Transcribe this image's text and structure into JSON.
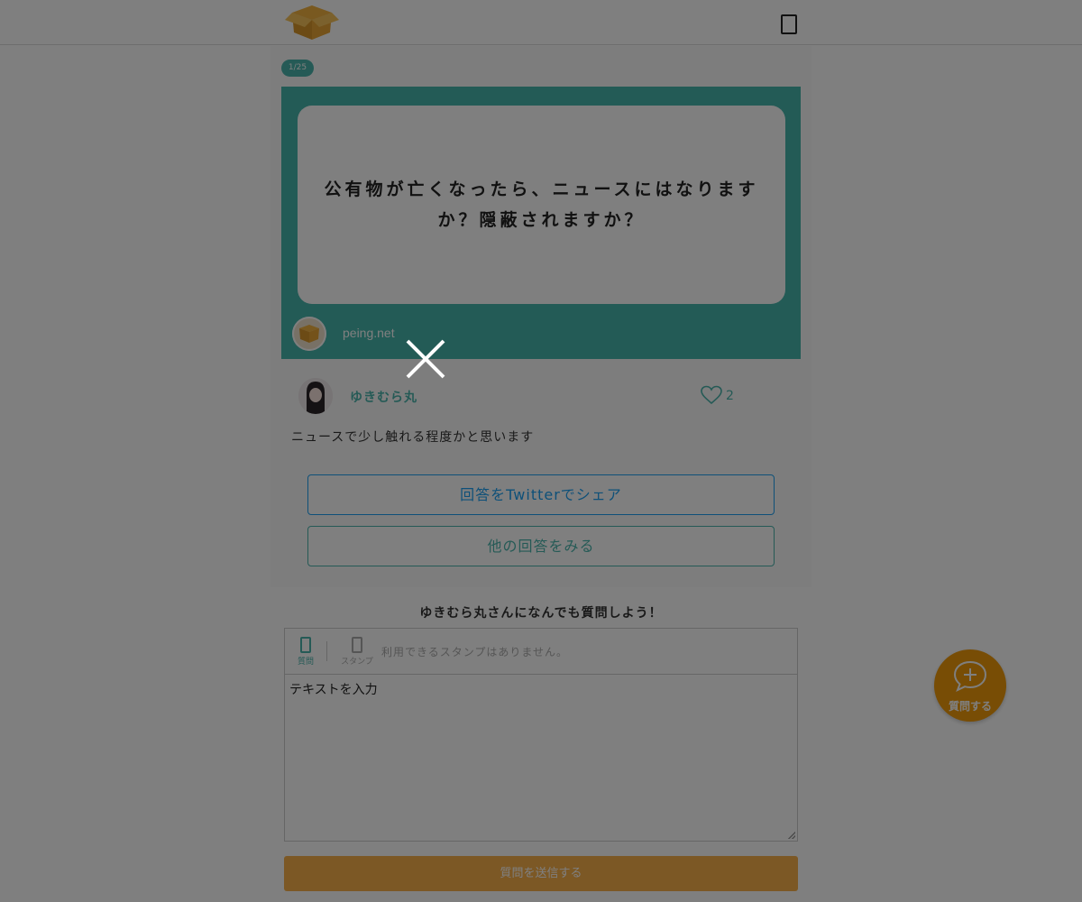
{
  "header": {
    "logo_icon": "box-logo-icon",
    "menu_icon": "menu-icon"
  },
  "card": {
    "page_indicator": "1/25",
    "question_text": "公有物が亡くなったら、ニュースにはなりますか？隠蔽されますか？",
    "brand_domain": "peing.net",
    "author_name": "ゆきむら丸",
    "like_count": "2",
    "answer_text": "ニュースで少し触れる程度かと思います",
    "share_button_label": "回答をTwitterでシェア",
    "more_button_label": "他の回答をみる"
  },
  "form": {
    "heading": "ゆきむら丸さんになんでも質問しよう！",
    "tab_question_label": "質問",
    "tab_stamp_label": "スタンプ",
    "stamp_note": "利用できるスタンプはありません。",
    "input_placeholder": "テキストを入力",
    "submit_label": "質問を送信する"
  },
  "fab": {
    "label": "質問する",
    "icon": "chat-plus-icon"
  },
  "colors": {
    "accent": "#4bb5ac",
    "twitter": "#1da1f2",
    "submit": "#f9b04a",
    "fab": "#f09a0a",
    "overlay": "rgba(0,0,0,0.5)"
  }
}
